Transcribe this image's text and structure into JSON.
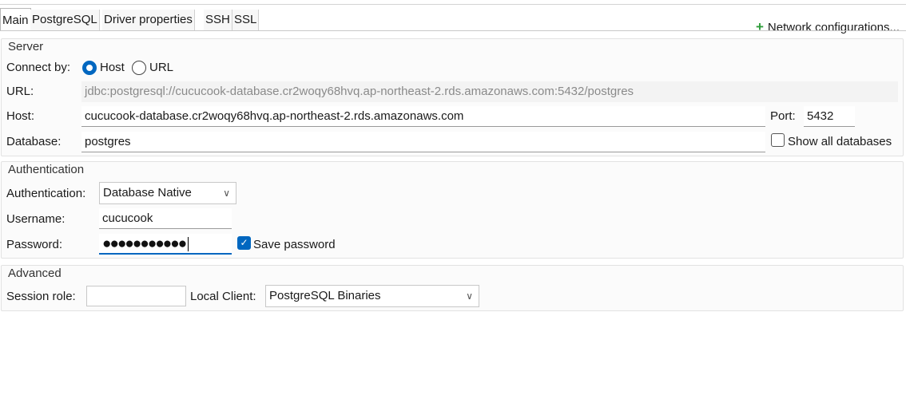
{
  "tabs": [
    "Main",
    "PostgreSQL",
    "Driver properties",
    "SSH",
    "SSL"
  ],
  "network": {
    "label": "Network configurations..."
  },
  "server": {
    "title": "Server",
    "connect_by_label": "Connect by:",
    "option_host": "Host",
    "option_url": "URL",
    "selected": "Host",
    "url_label": "URL:",
    "url_value": "jdbc:postgresql://cucucook-database.cr2woqy68hvq.ap-northeast-2.rds.amazonaws.com:5432/postgres",
    "host_label": "Host:",
    "host_value": "cucucook-database.cr2woqy68hvq.ap-northeast-2.rds.amazonaws.com",
    "port_label": "Port:",
    "port_value": "5432",
    "database_label": "Database:",
    "database_value": "postgres",
    "show_all_label": "Show all databases",
    "show_all_checked": false
  },
  "auth": {
    "title": "Authentication",
    "auth_label": "Authentication:",
    "auth_value": "Database Native",
    "username_label": "Username:",
    "username_value": "cucucook",
    "password_label": "Password:",
    "password_mask": "●●●●●●●●●●●",
    "save_password_label": "Save password",
    "save_password_checked": true
  },
  "advanced": {
    "title": "Advanced",
    "session_role_label": "Session role:",
    "session_role_value": "",
    "local_client_label": "Local Client:",
    "local_client_value": "PostgreSQL Binaries"
  },
  "colors": {
    "accent": "#0067c0",
    "add_icon": "#2e9d3a"
  },
  "icons": {
    "add": "plus-icon",
    "dropdown": "chevron-down-icon",
    "checked": "checkmark-icon"
  }
}
